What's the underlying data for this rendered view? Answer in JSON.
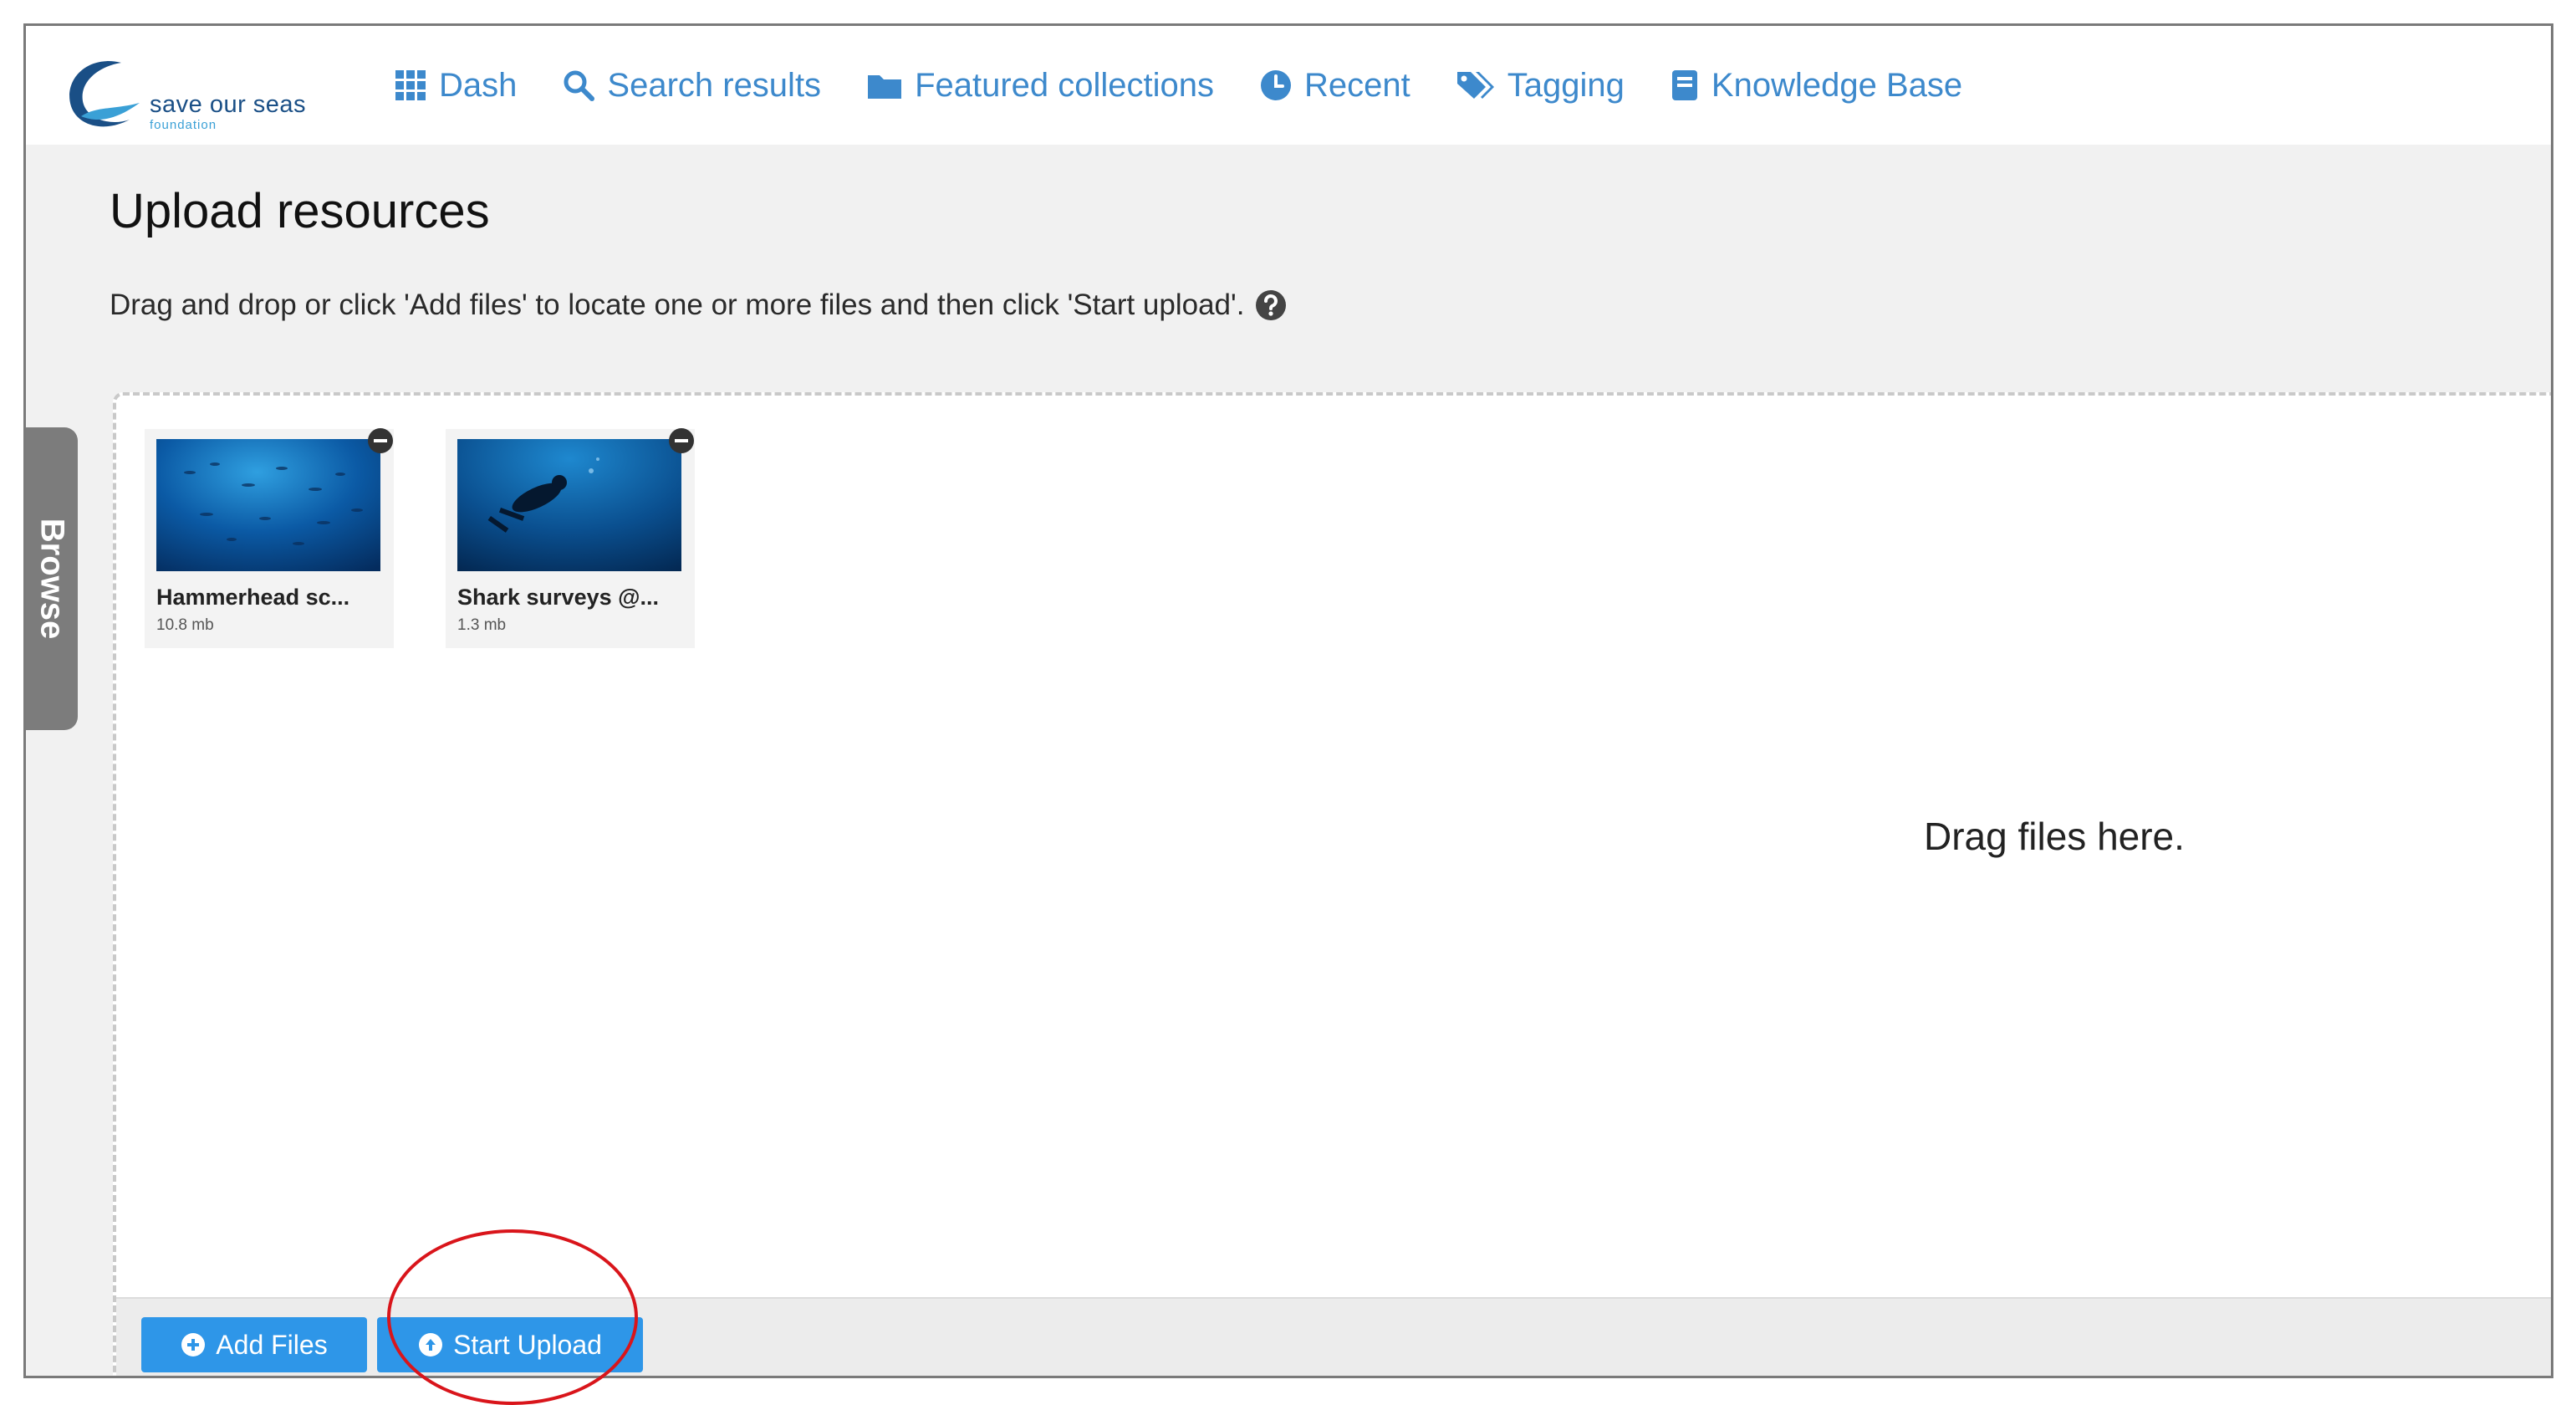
{
  "header": {
    "logo": {
      "brand": "save our seas",
      "sub": "foundation"
    },
    "nav": [
      {
        "label": "Dash",
        "icon": "grid-icon"
      },
      {
        "label": "Search results",
        "icon": "search-icon"
      },
      {
        "label": "Featured collections",
        "icon": "folder-icon"
      },
      {
        "label": "Recent",
        "icon": "clock-icon"
      },
      {
        "label": "Tagging",
        "icon": "tags-icon"
      },
      {
        "label": "Knowledge Base",
        "icon": "book-icon"
      }
    ]
  },
  "main": {
    "title": "Upload resources",
    "instructions": "Drag and drop or click 'Add files' to locate one or more files and then click 'Start upload'."
  },
  "sidebar_tab": {
    "label": "Browse"
  },
  "uploader": {
    "files": [
      {
        "name": "Hammerhead sc...",
        "size": "10.8 mb"
      },
      {
        "name": "Shark surveys @...",
        "size": "1.3 mb"
      }
    ],
    "drop_hint": "Drag files here.",
    "buttons": {
      "add": "Add Files",
      "start": "Start Upload"
    }
  },
  "colors": {
    "link": "#3d89cc",
    "button": "#2e96e8",
    "annotation": "#d9151b"
  }
}
